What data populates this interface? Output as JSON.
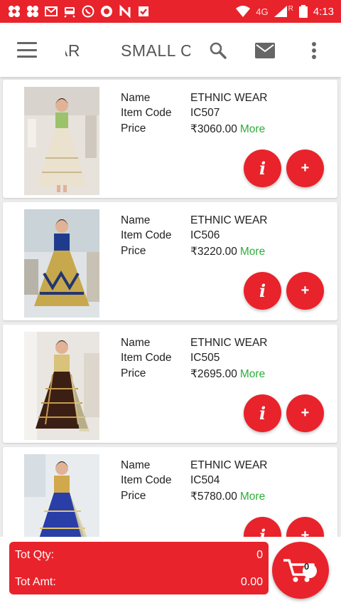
{
  "status_bar": {
    "time": "4:13",
    "network": "4G",
    "roaming": "R",
    "icons": [
      "nav-app-icon",
      "shop-app-icon",
      "gmail-icon",
      "train-app-icon",
      "whatsapp-icon",
      "compass-app-icon",
      "news-app-icon",
      "checkmark-app-icon"
    ]
  },
  "app_bar": {
    "title_left": "AR",
    "title_right": "SMALL CH",
    "icons": [
      "menu-icon",
      "search-icon",
      "mail-icon",
      "more-vert-icon"
    ]
  },
  "labels": {
    "name": "Name",
    "item_code": "Item Code",
    "price": "Price",
    "more": "More",
    "info_button": "i",
    "add_button": "+"
  },
  "products": [
    {
      "name": "ETHNIC WEAR",
      "item_code": "IC507",
      "price": "₹3060.00"
    },
    {
      "name": "ETHNIC WEAR",
      "item_code": "IC506",
      "price": "₹3220.00"
    },
    {
      "name": "ETHNIC WEAR",
      "item_code": "IC505",
      "price": "₹2695.00"
    },
    {
      "name": "ETHNIC WEAR",
      "item_code": "IC504",
      "price": "₹5780.00"
    }
  ],
  "totals": {
    "qty_label": "Tot Qty:",
    "qty_value": "0",
    "amt_label": "Tot Amt:",
    "amt_value": "0.00",
    "cart_count": "0"
  },
  "colors": {
    "accent": "#e8232b",
    "more_link": "#2eae3b"
  }
}
